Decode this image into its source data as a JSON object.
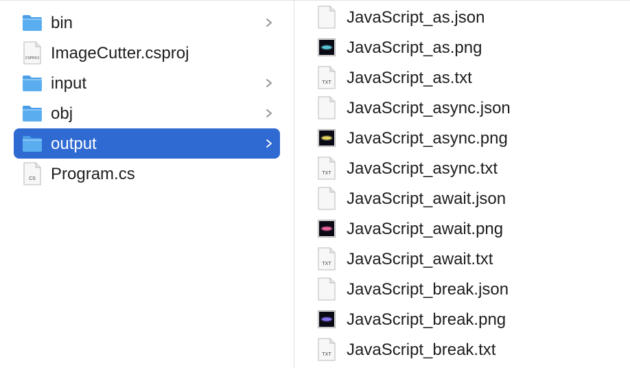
{
  "left_column": {
    "items": [
      {
        "label": "bin",
        "kind": "folder",
        "has_children": true,
        "selected": false
      },
      {
        "label": "ImageCutter.csproj",
        "kind": "csproj",
        "has_children": false,
        "selected": false,
        "icon_text": "CSPROJ"
      },
      {
        "label": "input",
        "kind": "folder",
        "has_children": true,
        "selected": false
      },
      {
        "label": "obj",
        "kind": "folder",
        "has_children": true,
        "selected": false
      },
      {
        "label": "output",
        "kind": "folder",
        "has_children": true,
        "selected": true
      },
      {
        "label": "Program.cs",
        "kind": "cs",
        "has_children": false,
        "selected": false,
        "icon_text": "CS"
      }
    ]
  },
  "right_column": {
    "items": [
      {
        "label": "JavaScript_as.json",
        "kind": "json"
      },
      {
        "label": "JavaScript_as.png",
        "kind": "png",
        "thumb_color": "#5fd3e6"
      },
      {
        "label": "JavaScript_as.txt",
        "kind": "txt",
        "icon_text": "TXT"
      },
      {
        "label": "JavaScript_async.json",
        "kind": "json"
      },
      {
        "label": "JavaScript_async.png",
        "kind": "png",
        "thumb_color": "#f5e26a"
      },
      {
        "label": "JavaScript_async.txt",
        "kind": "txt",
        "icon_text": "TXT"
      },
      {
        "label": "JavaScript_await.json",
        "kind": "json"
      },
      {
        "label": "JavaScript_await.png",
        "kind": "png",
        "thumb_color": "#ff6aa8"
      },
      {
        "label": "JavaScript_await.txt",
        "kind": "txt",
        "icon_text": "TXT"
      },
      {
        "label": "JavaScript_break.json",
        "kind": "json"
      },
      {
        "label": "JavaScript_break.png",
        "kind": "png",
        "thumb_color": "#8d7bff"
      },
      {
        "label": "JavaScript_break.txt",
        "kind": "txt",
        "icon_text": "TXT"
      }
    ]
  },
  "colors": {
    "selection": "#2f6ad3",
    "folder": "#5aaef0",
    "folder_tab": "#4a9de6",
    "divider": "#e0e0e0"
  }
}
